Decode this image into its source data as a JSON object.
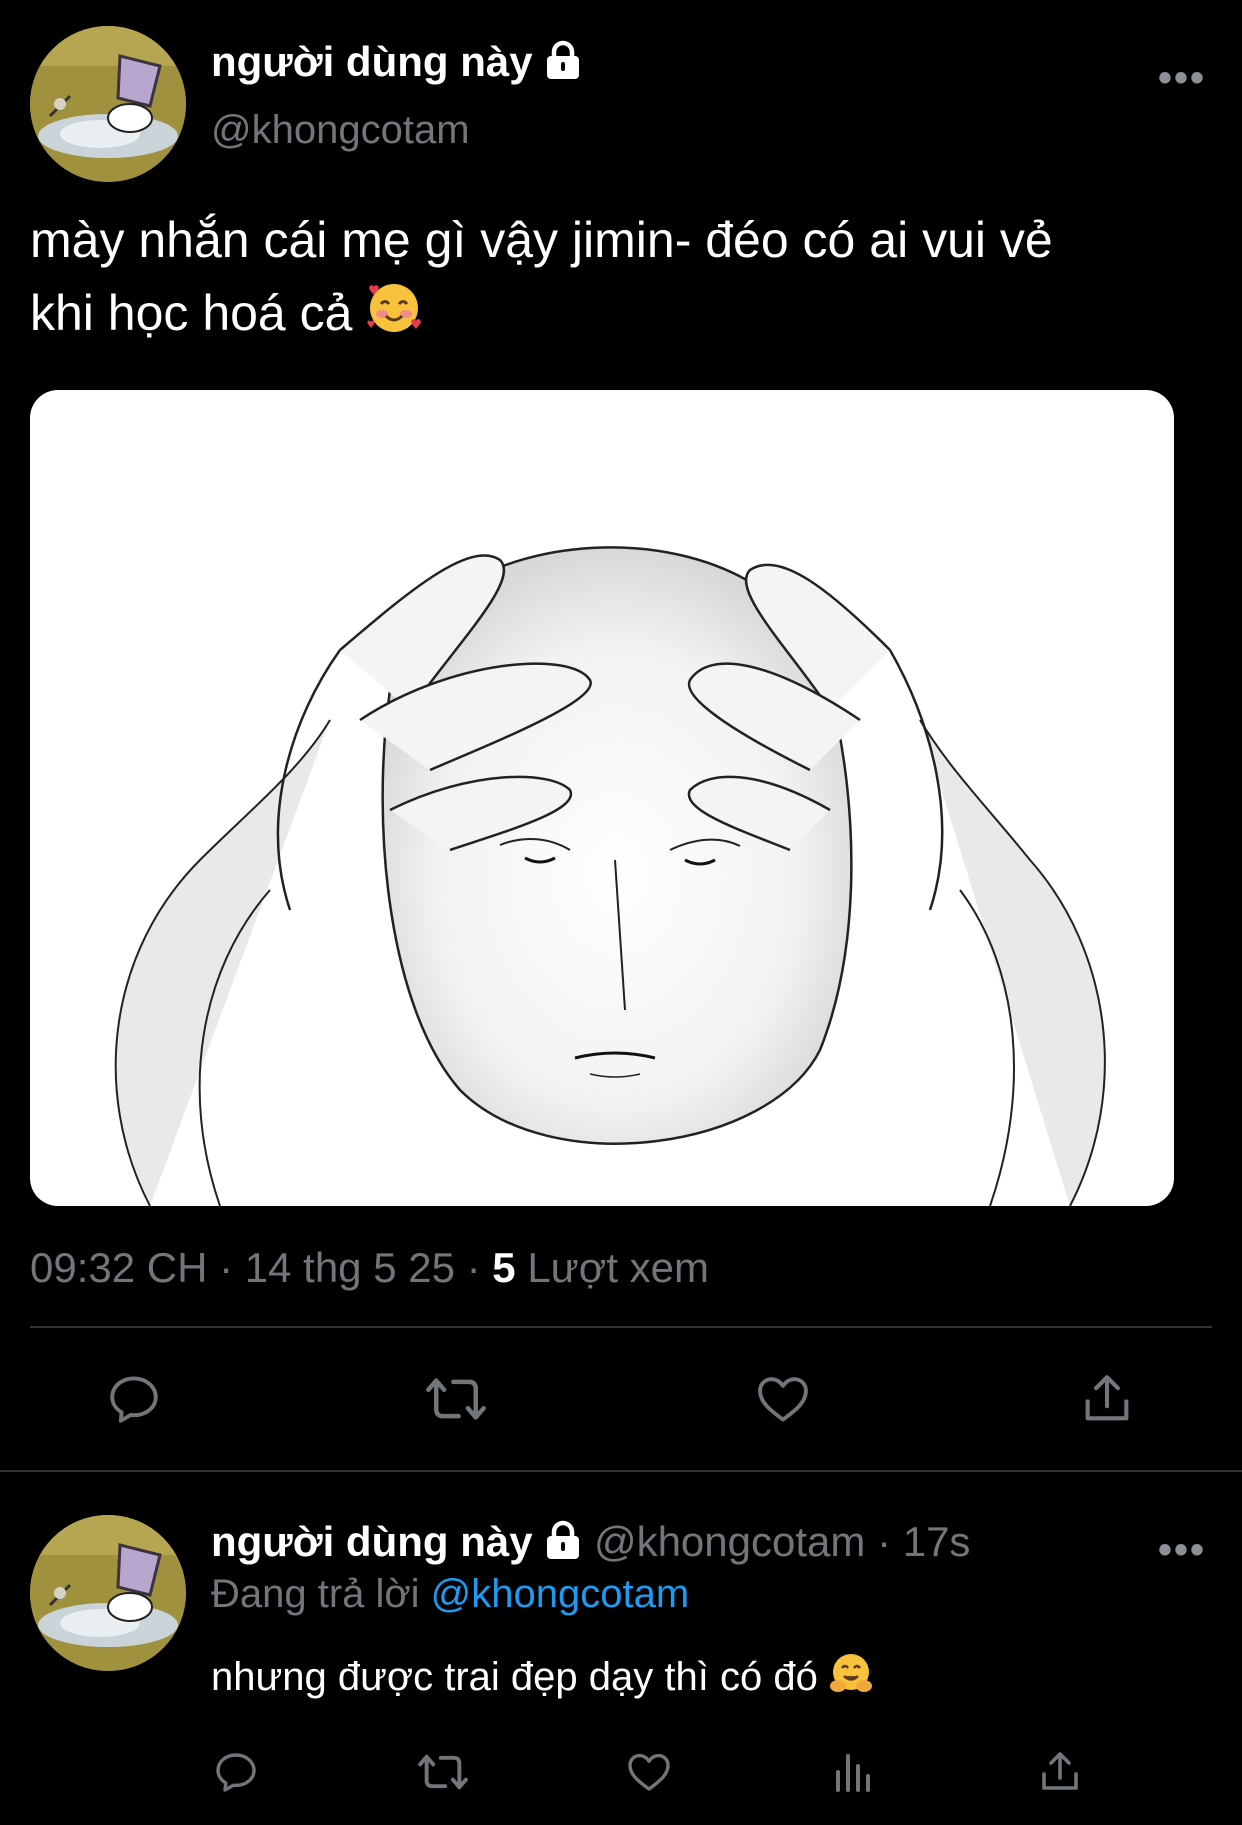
{
  "tweet": {
    "display_name": "người dùng này",
    "handle": "@khongcotam",
    "text_line1": "mày nhắn cái mẹ gì vậy jimin- đéo có ai vui vẻ",
    "text_line2": "khi học hoá cả",
    "text_emoji": "smiling-face-with-hearts",
    "time": "09:32 CH",
    "date": "14 thg 5 25",
    "views_count": "5",
    "views_label": "Lượt xem",
    "more_label": "•••"
  },
  "actions": [
    "reply",
    "retweet",
    "like",
    "share"
  ],
  "reply": {
    "display_name": "người dùng này",
    "handle": "@khongcotam",
    "age": "17s",
    "replying_prefix": "Đang trả lời",
    "replying_to": "@khongcotam",
    "text": "nhưng được trai đẹp dạy thì có đó",
    "text_emoji": "hugging-face",
    "more_label": "•••",
    "actions": [
      "reply",
      "retweet",
      "like",
      "views",
      "share"
    ]
  },
  "colors": {
    "background": "#000000",
    "text_primary": "#ffffff",
    "text_secondary": "#71767b",
    "link": "#1d9bf0",
    "divider": "#2f3336"
  }
}
